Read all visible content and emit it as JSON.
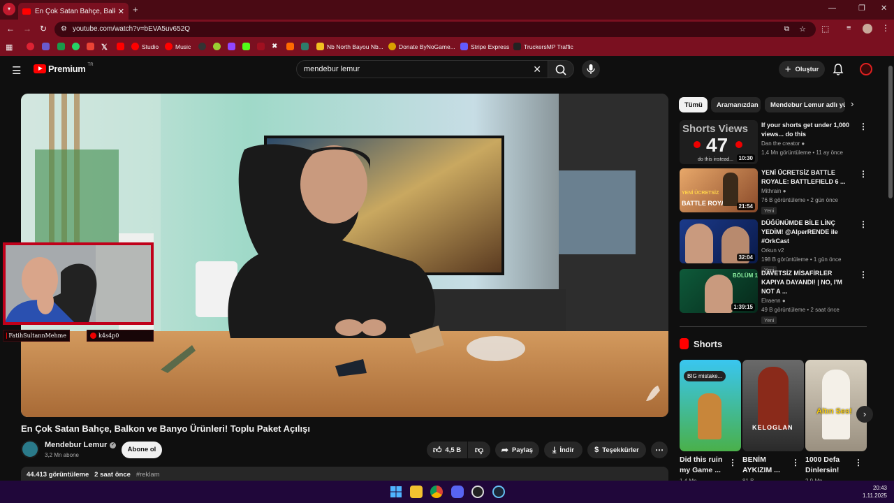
{
  "browser": {
    "tab_title": "En Çok Satan Bahçe, Balkon ve",
    "url": "youtube.com/watch?v=bEVA5uv652Q",
    "bookmarks": [
      {
        "label": "Studio"
      },
      {
        "label": "Music"
      },
      {
        "label": "Nb North Bayou Nb..."
      },
      {
        "label": "Donate ByNoGame..."
      },
      {
        "label": "Stripe Express"
      },
      {
        "label": "TruckersMP Traffic"
      }
    ]
  },
  "header": {
    "logo_text": "Premium",
    "logo_sup": "TR",
    "search_value": "mendebur lemur",
    "create_label": "Oluştur"
  },
  "video": {
    "title": "En Çok Satan Bahçe, Balkon ve Banyo Ürünleri! Toplu Paket Açılışı",
    "channel": "Mendebur Lemur",
    "subscribers": "3,2 Mn abone",
    "subscribe_label": "Abone ol",
    "likes": "4,5 B",
    "share_label": "Paylaş",
    "download_label": "İndir",
    "thanks_label": "Teşekkürler",
    "views": "44.413 görüntüleme",
    "time": "2 saat önce",
    "hashtag": "#reklam",
    "overlay_user1": "FatihSultannMehme",
    "overlay_user2": "k4s4p0"
  },
  "sidebar": {
    "chips": [
      "Tümü",
      "Aramanızdan",
      "Mendebur Lemur adlı yü"
    ],
    "videos": [
      {
        "title": "If your shorts get under 1,000 views... do this",
        "channel": "Dan the creator",
        "meta": "1,4 Mn görüntüleme • 11 ay önce",
        "duration": "10:30",
        "thumb_text_1": "Shorts Views",
        "thumb_text_2": "47",
        "thumb_text_3": "do this instead..."
      },
      {
        "title": "YENİ ÜCRETSİZ BATTLE ROYALE: BATTLEFIELD 6 ...",
        "channel": "Mithrain",
        "meta": "76 B görüntüleme • 2 gün önce",
        "duration": "21:54",
        "badge": "Yeni",
        "thumb_text_1": "YENİ ÜCRETSİZ",
        "thumb_text_2": "BATTLE ROYALE"
      },
      {
        "title": "DÜĞÜNÜMDE BİLE LİNÇ YEDİM! @AlperRENDE ile #OrkCast",
        "channel": "Orkun v2",
        "meta": "198 B görüntüleme • 1 gün önce",
        "duration": "32:04",
        "badge": "Yeni"
      },
      {
        "title": "DAVETSİZ MİSAFİRLER KAPIYA DAYANDI! | NO, I'M NOT A ...",
        "channel": "Elraenn",
        "meta": "49 B görüntüleme • 2 saat önce",
        "duration": "1:39:15",
        "badge": "Yeni",
        "thumb_text_1": "BÖLÜM 1"
      }
    ],
    "shorts_heading": "Shorts",
    "shorts": [
      {
        "title": "Did this ruin my Game ...",
        "meta": "1,4 Mn",
        "thumb_text": "BIG mistake..."
      },
      {
        "title": "BENİM AYKIZIM ...",
        "meta": "81 B",
        "thumb_text": "KELOGLAN"
      },
      {
        "title": "1000 Defa Dinlersin!",
        "meta": "2,9 Mn",
        "thumb_text": "Altın Ses!"
      }
    ]
  },
  "taskbar": {
    "time": "20:43",
    "date": "1.11.2025"
  },
  "colors": {
    "browser_frame": "#7a1020",
    "youtube_red": "#ff0000",
    "page_bg": "#0f0f0f",
    "taskbar": "#20073a"
  }
}
